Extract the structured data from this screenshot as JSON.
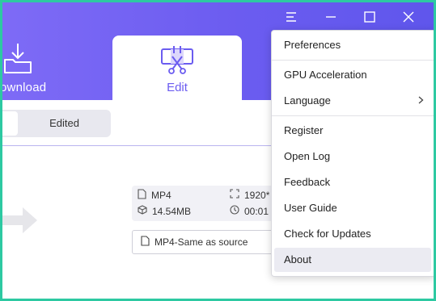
{
  "header": {
    "tabs": [
      {
        "label": "ownload",
        "icon": "download-folder-icon"
      },
      {
        "label": "Edit",
        "icon": "edit-scissors-icon"
      }
    ]
  },
  "window_controls": {
    "menu": "menu-icon",
    "minimize": "minimize-icon",
    "maximize": "maximize-icon",
    "close": "close-icon"
  },
  "segment": {
    "edited_label": "Edited"
  },
  "file_info": {
    "format": "MP4",
    "resolution": "1920*",
    "size": "14.54MB",
    "duration": "00:01"
  },
  "output_format": {
    "label": "MP4-Same as source"
  },
  "menu": {
    "items": [
      {
        "label": "Preferences"
      },
      {
        "label": "GPU Acceleration"
      },
      {
        "label": "Language"
      },
      {
        "label": "Register"
      },
      {
        "label": "Open Log"
      },
      {
        "label": "Feedback"
      },
      {
        "label": "User Guide"
      },
      {
        "label": "Check for Updates"
      },
      {
        "label": "About"
      }
    ]
  },
  "colors": {
    "accent": "#6b5cf0",
    "frame": "#2dc9a2"
  }
}
